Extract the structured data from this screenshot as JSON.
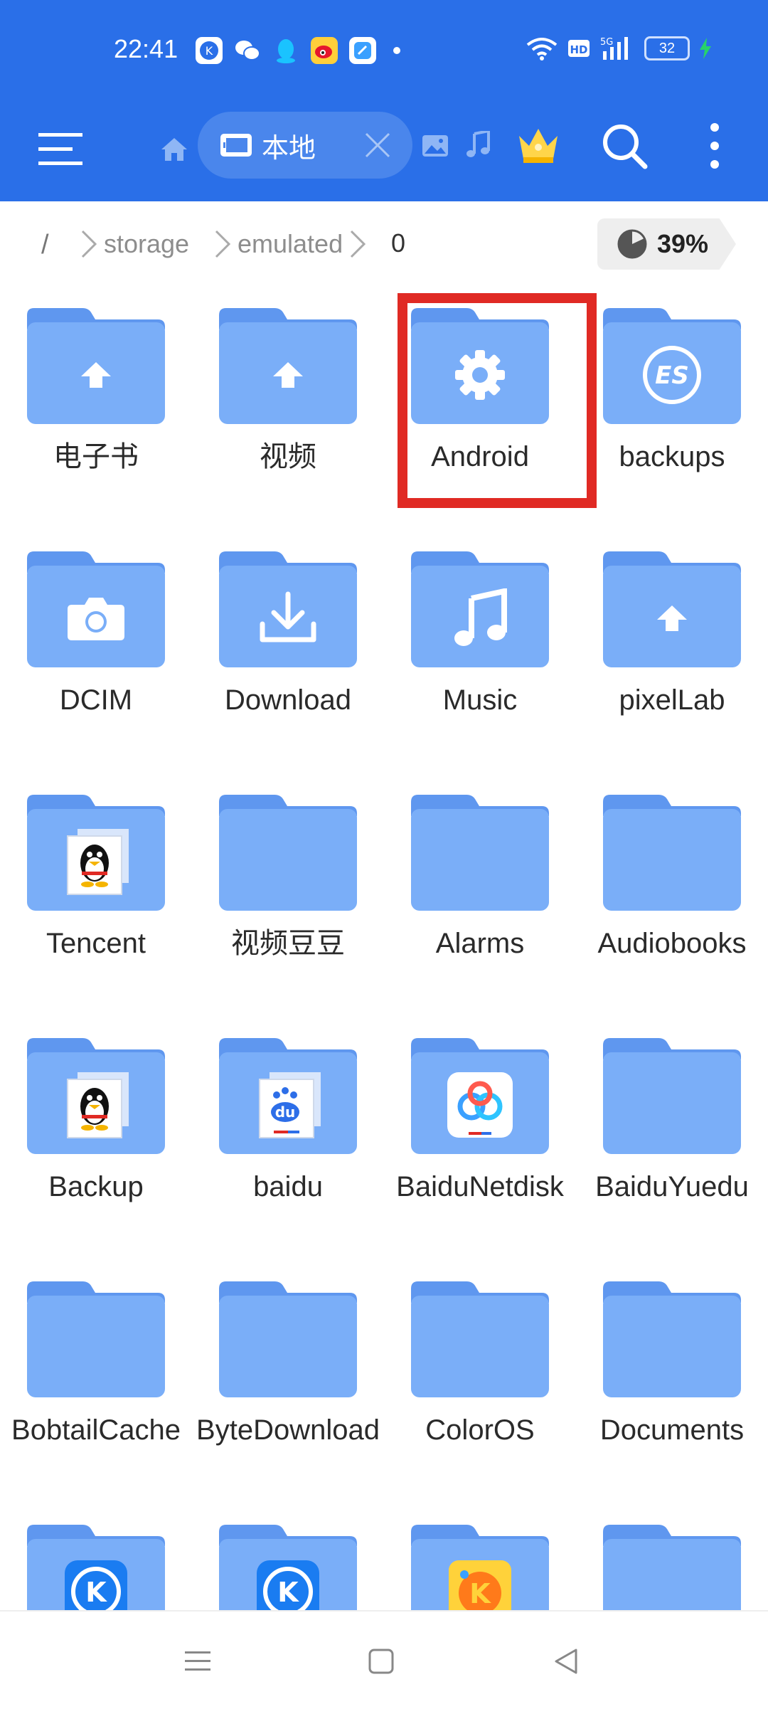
{
  "status_bar": {
    "time": "22:41",
    "battery": "32"
  },
  "toolbar": {
    "tab_label": "本地"
  },
  "breadcrumb": {
    "root": "/",
    "items": [
      "storage",
      "emulated",
      "0"
    ],
    "storage_usage": "39%"
  },
  "folders": [
    {
      "name": "电子书",
      "icon": "upload-arrow-icon"
    },
    {
      "name": "视频",
      "icon": "upload-arrow-icon"
    },
    {
      "name": "Android",
      "icon": "gear-icon"
    },
    {
      "name": "backups",
      "icon": "es-logo-icon"
    },
    {
      "name": "DCIM",
      "icon": "camera-icon"
    },
    {
      "name": "Download",
      "icon": "download-icon"
    },
    {
      "name": "Music",
      "icon": "music-note-icon"
    },
    {
      "name": "pixelLab",
      "icon": "upload-arrow-icon"
    },
    {
      "name": "Tencent",
      "icon": "qq-penguin-icon"
    },
    {
      "name": "视频豆豆",
      "icon": "folder-icon"
    },
    {
      "name": "Alarms",
      "icon": "folder-icon"
    },
    {
      "name": "Audiobooks",
      "icon": "folder-icon"
    },
    {
      "name": "Backup",
      "icon": "qq-penguin-icon"
    },
    {
      "name": "baidu",
      "icon": "baidu-paw-icon"
    },
    {
      "name": "BaiduNetdisk",
      "icon": "baidu-netdisk-icon"
    },
    {
      "name": "BaiduYuedu",
      "icon": "folder-icon"
    },
    {
      "name": "BobtailCache",
      "icon": "folder-icon"
    },
    {
      "name": "ByteDownload",
      "icon": "folder-icon"
    },
    {
      "name": "ColorOS",
      "icon": "folder-icon"
    },
    {
      "name": "Documents",
      "icon": "folder-icon"
    },
    {
      "name": "",
      "icon": "kugou-icon"
    },
    {
      "name": "",
      "icon": "kugou-icon"
    },
    {
      "name": "",
      "icon": "kuaikan-icon"
    },
    {
      "name": "",
      "icon": "folder-icon"
    }
  ],
  "colors": {
    "header": "#2a6fe8",
    "folder": "#7aaef8",
    "folder_tab": "#5f97ef",
    "highlight": "#e02a24"
  }
}
